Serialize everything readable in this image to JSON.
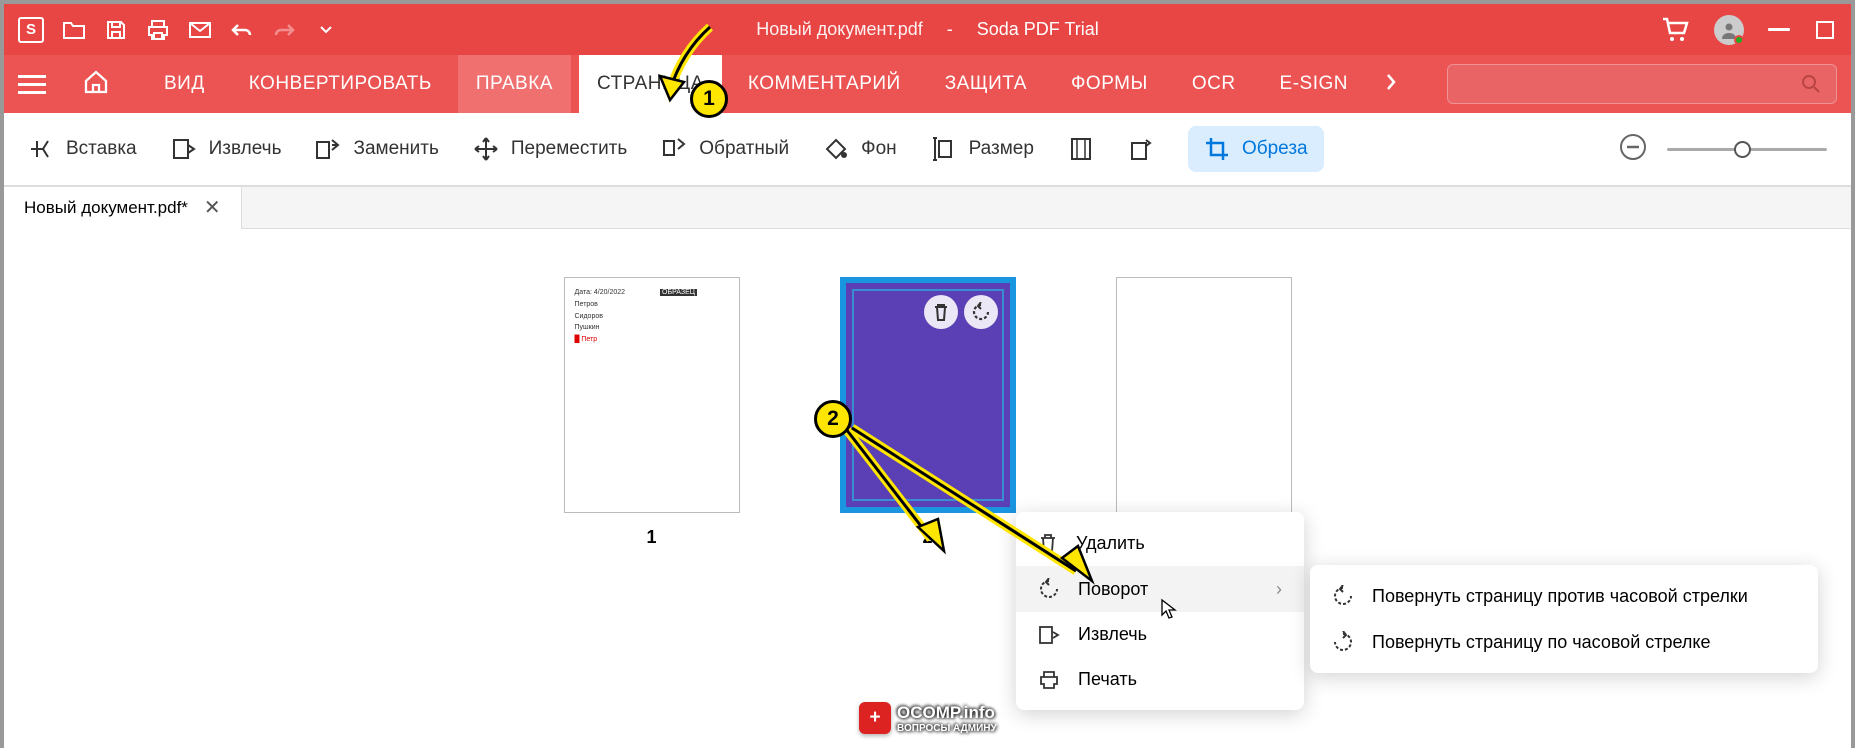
{
  "title": {
    "doc": "Новый документ.pdf",
    "app": "Soda PDF Trial"
  },
  "tabs": {
    "view": "ВИД",
    "convert": "КОНВЕРТИРОВАТЬ",
    "edit": "ПРАВКА",
    "page": "СТРАНИЦА",
    "comment": "КОММЕНТАРИЙ",
    "protect": "ЗАЩИТА",
    "forms": "ФОРМЫ",
    "ocr": "OCR",
    "esign": "E-SIGN"
  },
  "toolbar": {
    "insert": "Вставка",
    "extract": "Извлечь",
    "replace": "Заменить",
    "move": "Переместить",
    "reverse": "Обратный",
    "bg": "Фон",
    "size": "Размер",
    "crop": "Обреза"
  },
  "doc_tab": "Новый документ.pdf*",
  "pages": {
    "p1": "1",
    "p2": "2"
  },
  "callouts": {
    "c1": "1",
    "c2": "2"
  },
  "context": {
    "delete": "Удалить",
    "rotate": "Поворот",
    "extract": "Извлечь",
    "print": "Печать"
  },
  "submenu": {
    "ccw": "Повернуть страницу против часовой стрелки",
    "cw": "Повернуть страницу по часовой стрелке"
  },
  "watermark": {
    "main": "OCOMP.info",
    "sub": "ВОПРОСЫ АДМИНУ"
  },
  "app_letter": "S"
}
